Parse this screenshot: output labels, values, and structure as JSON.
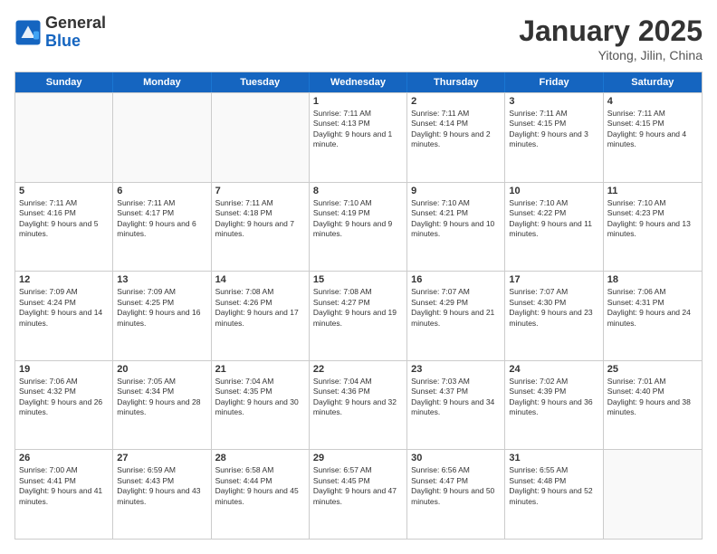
{
  "logo": {
    "general": "General",
    "blue": "Blue"
  },
  "header": {
    "month": "January 2025",
    "location": "Yitong, Jilin, China"
  },
  "days": [
    "Sunday",
    "Monday",
    "Tuesday",
    "Wednesday",
    "Thursday",
    "Friday",
    "Saturday"
  ],
  "rows": [
    [
      {
        "day": "",
        "empty": true
      },
      {
        "day": "",
        "empty": true
      },
      {
        "day": "",
        "empty": true
      },
      {
        "day": "1",
        "rise": "7:11 AM",
        "set": "4:13 PM",
        "daylight": "Daylight: 9 hours and 1 minute."
      },
      {
        "day": "2",
        "rise": "7:11 AM",
        "set": "4:14 PM",
        "daylight": "Daylight: 9 hours and 2 minutes."
      },
      {
        "day": "3",
        "rise": "7:11 AM",
        "set": "4:15 PM",
        "daylight": "Daylight: 9 hours and 3 minutes."
      },
      {
        "day": "4",
        "rise": "7:11 AM",
        "set": "4:15 PM",
        "daylight": "Daylight: 9 hours and 4 minutes."
      }
    ],
    [
      {
        "day": "5",
        "rise": "7:11 AM",
        "set": "4:16 PM",
        "daylight": "Daylight: 9 hours and 5 minutes."
      },
      {
        "day": "6",
        "rise": "7:11 AM",
        "set": "4:17 PM",
        "daylight": "Daylight: 9 hours and 6 minutes."
      },
      {
        "day": "7",
        "rise": "7:11 AM",
        "set": "4:18 PM",
        "daylight": "Daylight: 9 hours and 7 minutes."
      },
      {
        "day": "8",
        "rise": "7:10 AM",
        "set": "4:19 PM",
        "daylight": "Daylight: 9 hours and 9 minutes."
      },
      {
        "day": "9",
        "rise": "7:10 AM",
        "set": "4:21 PM",
        "daylight": "Daylight: 9 hours and 10 minutes."
      },
      {
        "day": "10",
        "rise": "7:10 AM",
        "set": "4:22 PM",
        "daylight": "Daylight: 9 hours and 11 minutes."
      },
      {
        "day": "11",
        "rise": "7:10 AM",
        "set": "4:23 PM",
        "daylight": "Daylight: 9 hours and 13 minutes."
      }
    ],
    [
      {
        "day": "12",
        "rise": "7:09 AM",
        "set": "4:24 PM",
        "daylight": "Daylight: 9 hours and 14 minutes."
      },
      {
        "day": "13",
        "rise": "7:09 AM",
        "set": "4:25 PM",
        "daylight": "Daylight: 9 hours and 16 minutes."
      },
      {
        "day": "14",
        "rise": "7:08 AM",
        "set": "4:26 PM",
        "daylight": "Daylight: 9 hours and 17 minutes."
      },
      {
        "day": "15",
        "rise": "7:08 AM",
        "set": "4:27 PM",
        "daylight": "Daylight: 9 hours and 19 minutes."
      },
      {
        "day": "16",
        "rise": "7:07 AM",
        "set": "4:29 PM",
        "daylight": "Daylight: 9 hours and 21 minutes."
      },
      {
        "day": "17",
        "rise": "7:07 AM",
        "set": "4:30 PM",
        "daylight": "Daylight: 9 hours and 23 minutes."
      },
      {
        "day": "18",
        "rise": "7:06 AM",
        "set": "4:31 PM",
        "daylight": "Daylight: 9 hours and 24 minutes."
      }
    ],
    [
      {
        "day": "19",
        "rise": "7:06 AM",
        "set": "4:32 PM",
        "daylight": "Daylight: 9 hours and 26 minutes."
      },
      {
        "day": "20",
        "rise": "7:05 AM",
        "set": "4:34 PM",
        "daylight": "Daylight: 9 hours and 28 minutes."
      },
      {
        "day": "21",
        "rise": "7:04 AM",
        "set": "4:35 PM",
        "daylight": "Daylight: 9 hours and 30 minutes."
      },
      {
        "day": "22",
        "rise": "7:04 AM",
        "set": "4:36 PM",
        "daylight": "Daylight: 9 hours and 32 minutes."
      },
      {
        "day": "23",
        "rise": "7:03 AM",
        "set": "4:37 PM",
        "daylight": "Daylight: 9 hours and 34 minutes."
      },
      {
        "day": "24",
        "rise": "7:02 AM",
        "set": "4:39 PM",
        "daylight": "Daylight: 9 hours and 36 minutes."
      },
      {
        "day": "25",
        "rise": "7:01 AM",
        "set": "4:40 PM",
        "daylight": "Daylight: 9 hours and 38 minutes."
      }
    ],
    [
      {
        "day": "26",
        "rise": "7:00 AM",
        "set": "4:41 PM",
        "daylight": "Daylight: 9 hours and 41 minutes."
      },
      {
        "day": "27",
        "rise": "6:59 AM",
        "set": "4:43 PM",
        "daylight": "Daylight: 9 hours and 43 minutes."
      },
      {
        "day": "28",
        "rise": "6:58 AM",
        "set": "4:44 PM",
        "daylight": "Daylight: 9 hours and 45 minutes."
      },
      {
        "day": "29",
        "rise": "6:57 AM",
        "set": "4:45 PM",
        "daylight": "Daylight: 9 hours and 47 minutes."
      },
      {
        "day": "30",
        "rise": "6:56 AM",
        "set": "4:47 PM",
        "daylight": "Daylight: 9 hours and 50 minutes."
      },
      {
        "day": "31",
        "rise": "6:55 AM",
        "set": "4:48 PM",
        "daylight": "Daylight: 9 hours and 52 minutes."
      },
      {
        "day": "",
        "empty": true
      }
    ]
  ]
}
